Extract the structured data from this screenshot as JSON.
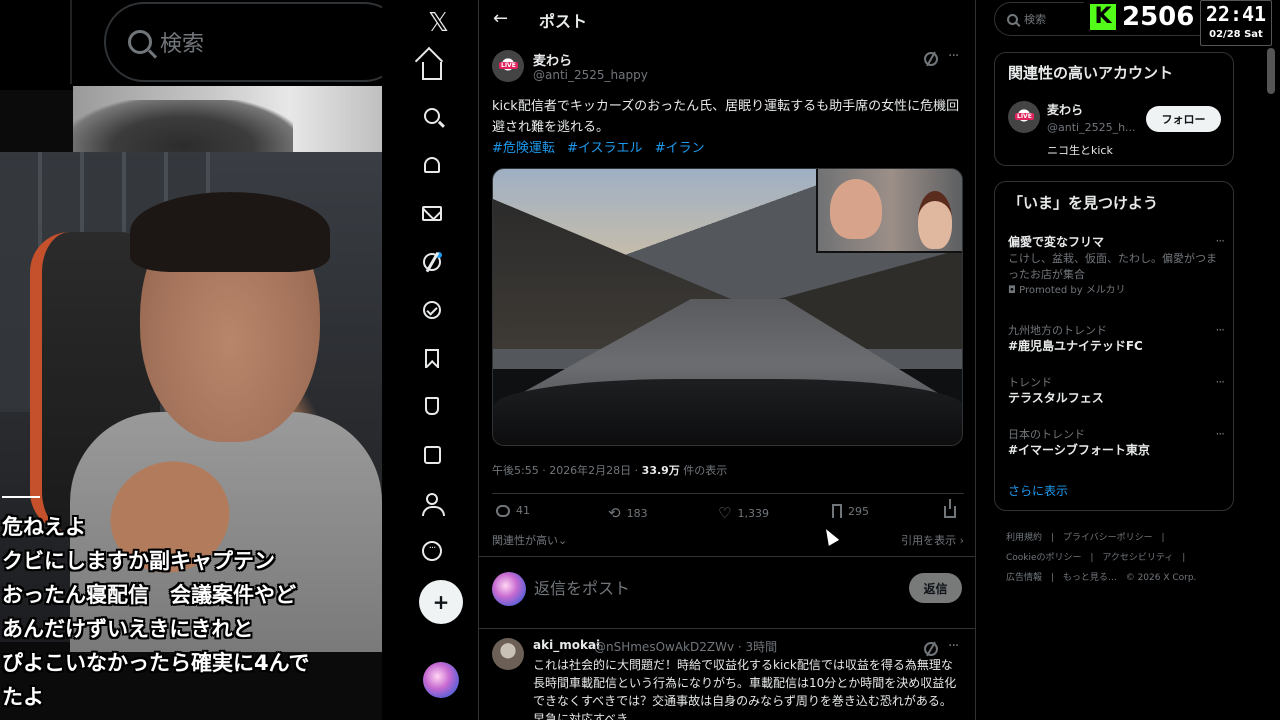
{
  "left": {
    "search_placeholder": "検索",
    "captions": [
      "危ねえよ",
      "クビにしますか副キャプテン",
      "おったん寝配信　会議案件やど",
      "あんだけずいえきにきれと",
      "ぴよこいなかったら確実に4んで",
      "たよ"
    ]
  },
  "nav": {
    "logo": "𝕏",
    "items": [
      "home-icon",
      "search-icon",
      "notifications-icon",
      "messages-icon",
      "grok-icon",
      "verified-icon",
      "bookmarks-icon",
      "labs-icon",
      "articles-icon",
      "profile-icon",
      "more-icon"
    ],
    "post_glyph": "+"
  },
  "main": {
    "back": "←",
    "title": "ポスト",
    "tweet": {
      "name": "麦わら",
      "handle": "@anti_2525_happy",
      "live": "LIVE",
      "more": "···",
      "text": "kick配信者でキッカーズのおったん氏、居眠り運転するも助手席の女性に危機回避され難を逃れる。",
      "tags": [
        "#危険運転",
        "#イスラエル",
        "#イラン"
      ],
      "time": "午後5:55 · 2026年2月28日 · ",
      "views_count": "33.9万",
      "views_label": " 件の表示",
      "replies": "41",
      "retweets": "183",
      "likes": "1,339",
      "bookmarks": "295",
      "sort_left": "関連性が高い⌄",
      "sort_right": "引用を表示 ›"
    },
    "reply_box": {
      "placeholder": "返信をポスト",
      "button": "返信"
    },
    "reply": {
      "name": "aki_mokai",
      "handle": "@nSHmesOwAkD2ZWv · 3時間",
      "more": "···",
      "text": "これは社会的に大問題だ！時給で収益化するkick配信では収益を得る為無理な長時間車載配信という行為になりがち。車載配信は10分とか時間を決め収益化できなくすべきでは？交通事故は自身のみならず周りを巻き込む恐れがある。早急に対応すべき。"
    }
  },
  "right": {
    "search_placeholder": "検索",
    "kick_logo": "K",
    "kick_count": "2506",
    "clock_time": "22:41",
    "clock_date": "02/28 Sat",
    "related": {
      "title": "関連性の高いアカウント",
      "name": "麦わら",
      "handle": "@anti_2525_h...",
      "bio": "ニコ生とkick",
      "follow": "フォロー",
      "live": "LIVE"
    },
    "trends": {
      "title": "「いま」を見つけよう",
      "items": [
        {
          "name": "偏愛で変なフリマ",
          "desc": "こけし、盆栽、仮面、たわし。偏愛がつまったお店が集合",
          "promo": "◘ Promoted by メルカリ"
        },
        {
          "ctx": "九州地方のトレンド",
          "name": "#鹿児島ユナイテッドFC"
        },
        {
          "ctx": "トレンド",
          "name": "テラスタルフェス"
        },
        {
          "ctx": "日本のトレンド",
          "name": "#イマーシブフォート東京"
        }
      ],
      "dots": "···",
      "show_more": "さらに表示"
    },
    "footer": [
      "利用規約",
      "|",
      "プライバシーポリシー",
      "|",
      "Cookieのポリシー",
      "|",
      "アクセシビリティ",
      "|",
      "広告情報",
      "|",
      "もっと見る…",
      "© 2026 X Corp."
    ]
  },
  "colors": {
    "accent": "#1d9bf0",
    "kick": "#53fc18",
    "bg": "#000000",
    "text": "#e7e9ea",
    "muted": "#71767b"
  }
}
